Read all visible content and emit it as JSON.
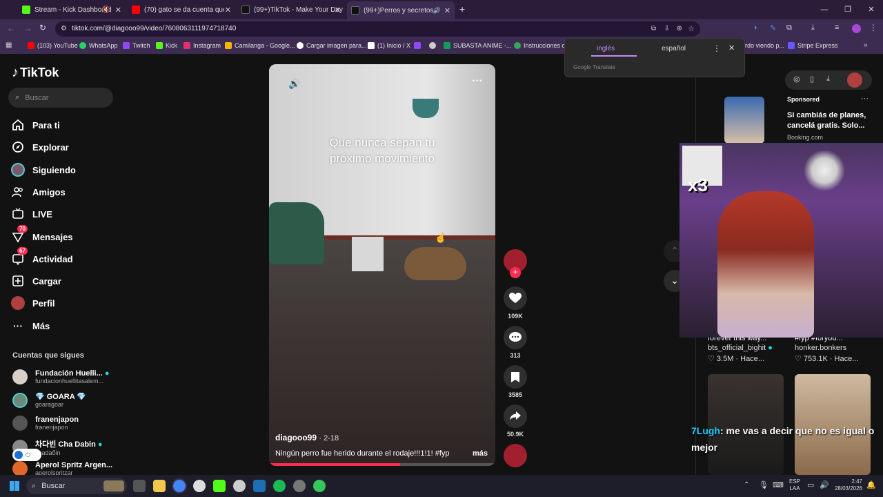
{
  "browser": {
    "tabs": [
      {
        "title": "Stream - Kick Dashboard",
        "color": "#53fc18"
      },
      {
        "title": "(70) gato se da cuenta que lo g",
        "color": "#ff0000"
      },
      {
        "title": "(99+)TikTok - Make Your Day",
        "color": "#ffffff"
      },
      {
        "title": "(99+)Perros y secretos en el",
        "color": "#ffffff"
      }
    ],
    "url": "tiktok.com/@diagooo99/video/7608063111974718740",
    "bookmarks": [
      {
        "label": "(103) YouTube",
        "color": "#ff0000"
      },
      {
        "label": "WhatsApp",
        "color": "#25d366"
      },
      {
        "label": "Twitch",
        "color": "#9146ff"
      },
      {
        "label": "Kick",
        "color": "#53fc18"
      },
      {
        "label": "Instagram",
        "color": "#e1306c"
      },
      {
        "label": "Camilanga - Google...",
        "color": "#f4b400"
      },
      {
        "label": "Cargar imagen para...",
        "color": "#ffffff"
      },
      {
        "label": "(1) Inicio / X",
        "color": "#ffffff"
      },
      {
        "label": "",
        "color": "#9146ff"
      },
      {
        "label": "",
        "color": "#cccccc"
      },
      {
        "label": "SUBASTA ANIME -...",
        "color": "#0f9d58"
      },
      {
        "label": "Instrucciones de",
        "color": "#34a853"
      },
      {
        "label": "rdo viendo p...",
        "color": "#cccccc"
      },
      {
        "label": "Stripe Express",
        "color": "#635bff"
      }
    ]
  },
  "translate_popup": {
    "lang_from": "inglés",
    "lang_to": "español",
    "brand": "Google Translate"
  },
  "sidebar": {
    "logo": "TikTok",
    "search_placeholder": "Buscar",
    "nav": [
      {
        "label": "Para ti",
        "icon": "home-icon"
      },
      {
        "label": "Explorar",
        "icon": "compass-icon"
      },
      {
        "label": "Siguiendo",
        "icon": "following-icon"
      },
      {
        "label": "Amigos",
        "icon": "friends-icon"
      },
      {
        "label": "LIVE",
        "icon": "live-icon"
      },
      {
        "label": "Mensajes",
        "icon": "messages-icon",
        "badge": "70"
      },
      {
        "label": "Actividad",
        "icon": "activity-icon",
        "badge": "67"
      },
      {
        "label": "Cargar",
        "icon": "upload-icon"
      },
      {
        "label": "Perfil",
        "icon": "profile-icon"
      },
      {
        "label": "Más",
        "icon": "more-icon"
      }
    ],
    "following_title": "Cuentas que sigues",
    "following": [
      {
        "name": "Fundación Huelli...",
        "handle": "fundacionhuellitasalem...",
        "verified": true
      },
      {
        "name": "💎 GOARA 💎",
        "handle": "goaragoar",
        "verified": false
      },
      {
        "name": "franenjapon",
        "handle": "franenjapon",
        "verified": false
      },
      {
        "name": "차다빈 Cha Dabin",
        "handle": "chadaбin",
        "verified": true
      },
      {
        "name": "Aperol Spritz Argen...",
        "handle": "aperolspritzar",
        "verified": false
      }
    ]
  },
  "video": {
    "overlay_text_line1": "Que nunca sepan tu",
    "overlay_text_line2": "próximo movimiento",
    "author": "diagooo99",
    "date": "· 2-18",
    "caption": "Ningún perro fue herido durante el rodaje!!!1!1! #fyp",
    "more": "más",
    "progress": 0.58
  },
  "actions": {
    "likes": "109K",
    "comments": "313",
    "saves": "3585",
    "shares": "50.9K"
  },
  "right_panel": {
    "sponsored_label": "Sponsored",
    "ad_text": "Si cambiás de planes, cancelá gratis. Solo...",
    "ad_source": "Booking.com",
    "cards": [
      {
        "caption": "forever this way...",
        "user": "bts_official_bighit",
        "stats": "♡ 3.5M · Hace..."
      },
      {
        "caption": "#fyp #foryou...",
        "user": "honker.bonkers",
        "stats": "♡ 753.1K · Hace..."
      }
    ]
  },
  "stream_overlay": {
    "multiplier": "x3",
    "chat_user": "7Lugh",
    "chat_message": ": me vas a decir que no es igual o mejor"
  },
  "taskbar": {
    "search_placeholder": "Buscar",
    "lang": "ESP",
    "region": "LAA",
    "time": "2:47",
    "date": "28/03/2026"
  }
}
